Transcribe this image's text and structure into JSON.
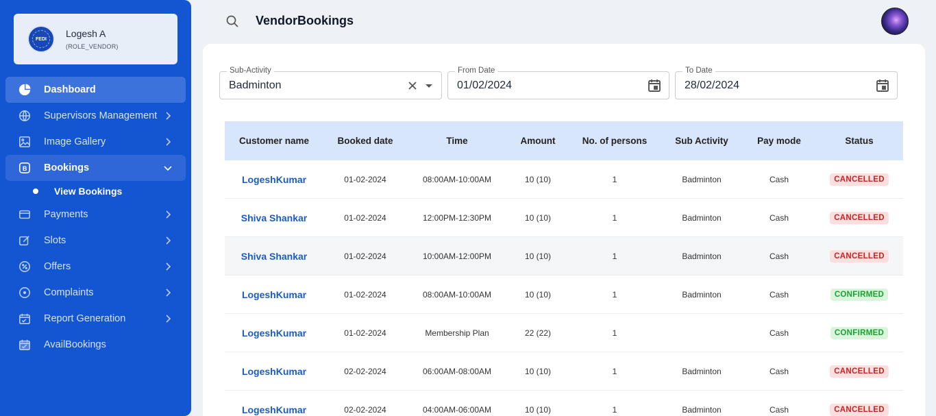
{
  "user": {
    "name": "Logesh A",
    "role": "(ROLE_VENDOR)",
    "logo_text": "FEDI"
  },
  "nav": {
    "items": [
      {
        "label": "Dashboard",
        "icon": "pie-chart-icon"
      },
      {
        "label": "Supervisors Management",
        "icon": "globe-icon"
      },
      {
        "label": "Image Gallery",
        "icon": "image-gallery-icon"
      },
      {
        "label": "Bookings",
        "icon": "bookings-icon"
      },
      {
        "label": "Payments",
        "icon": "credit-card-icon"
      },
      {
        "label": "Slots",
        "icon": "edit-icon"
      },
      {
        "label": "Offers",
        "icon": "offer-badge-icon"
      },
      {
        "label": "Complaints",
        "icon": "target-icon"
      },
      {
        "label": "Report Generation",
        "icon": "calendar-report-icon"
      },
      {
        "label": "AvailBookings",
        "icon": "calendar-check-icon"
      }
    ],
    "sub_item": "View Bookings"
  },
  "header": {
    "title": "VendorBookings"
  },
  "filters": {
    "sub_activity": {
      "label": "Sub-Activity",
      "value": "Badminton"
    },
    "from_date": {
      "label": "From Date",
      "value": "01/02/2024"
    },
    "to_date": {
      "label": "To Date",
      "value": "28/02/2024"
    }
  },
  "table": {
    "headers": [
      "Customer name",
      "Booked date",
      "Time",
      "Amount",
      "No. of persons",
      "Sub Activity",
      "Pay mode",
      "Status"
    ],
    "rows": [
      {
        "customer": "LogeshKumar",
        "date": "01-02-2024",
        "time": "08:00AM-10:00AM",
        "amount": "10 (10)",
        "persons": "1",
        "sub_activity": "Badminton",
        "pay_mode": "Cash",
        "status": "CANCELLED"
      },
      {
        "customer": "Shiva Shankar",
        "date": "01-02-2024",
        "time": "12:00PM-12:30PM",
        "amount": "10 (10)",
        "persons": "1",
        "sub_activity": "Badminton",
        "pay_mode": "Cash",
        "status": "CANCELLED"
      },
      {
        "customer": "Shiva Shankar",
        "date": "01-02-2024",
        "time": "10:00AM-12:00PM",
        "amount": "10 (10)",
        "persons": "1",
        "sub_activity": "Badminton",
        "pay_mode": "Cash",
        "status": "CANCELLED"
      },
      {
        "customer": "LogeshKumar",
        "date": "01-02-2024",
        "time": "08:00AM-10:00AM",
        "amount": "10 (10)",
        "persons": "1",
        "sub_activity": "Badminton",
        "pay_mode": "Cash",
        "status": "CONFIRMED"
      },
      {
        "customer": "LogeshKumar",
        "date": "01-02-2024",
        "time": "Membership Plan",
        "amount": "22 (22)",
        "persons": "1",
        "sub_activity": "",
        "pay_mode": "Cash",
        "status": "CONFIRMED"
      },
      {
        "customer": "LogeshKumar",
        "date": "02-02-2024",
        "time": "06:00AM-08:00AM",
        "amount": "10 (10)",
        "persons": "1",
        "sub_activity": "Badminton",
        "pay_mode": "Cash",
        "status": "CANCELLED"
      },
      {
        "customer": "LogeshKumar",
        "date": "02-02-2024",
        "time": "04:00AM-06:00AM",
        "amount": "10 (10)",
        "persons": "1",
        "sub_activity": "Badminton",
        "pay_mode": "Cash",
        "status": "CANCELLED"
      }
    ]
  },
  "colors": {
    "sidebar": "#1456d1",
    "accent": "#1a5bc4",
    "cancelled": "#c52424",
    "confirmed": "#16a32f",
    "table_header": "#d7e6fb"
  }
}
